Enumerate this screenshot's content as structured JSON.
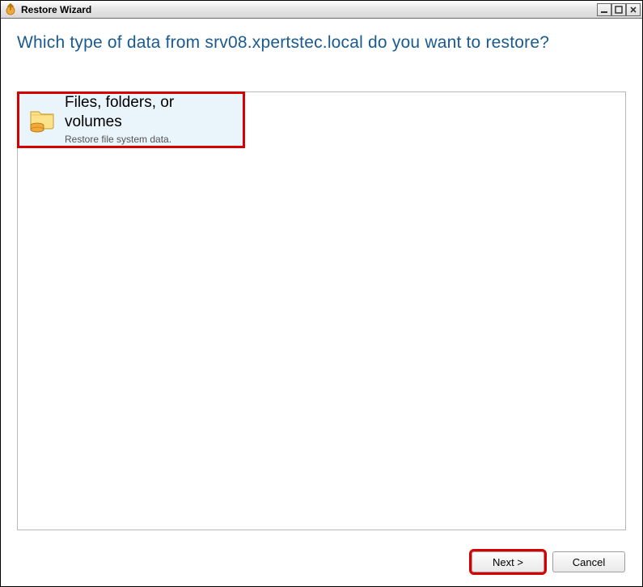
{
  "window": {
    "title": "Restore Wizard"
  },
  "heading": "Which type of data from srv08.xpertstec.local do you want to restore?",
  "options": [
    {
      "title": "Files, folders, or volumes",
      "description": "Restore file system data."
    }
  ],
  "buttons": {
    "next": "Next >",
    "cancel": "Cancel"
  }
}
